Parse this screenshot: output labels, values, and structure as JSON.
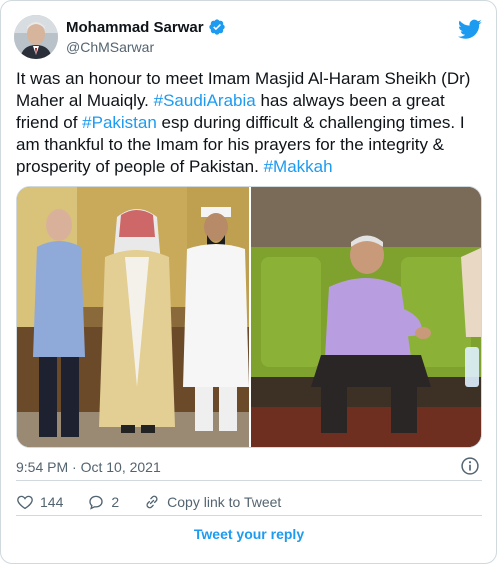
{
  "author": {
    "display_name": "Mohammad Sarwar",
    "handle": "@ChMSarwar"
  },
  "tweet": {
    "segments": [
      {
        "text": "It was an honour to meet Imam Masjid Al-Haram Sheikh (Dr) Maher al Muaiqly. ",
        "link": false
      },
      {
        "text": "#SaudiArabia",
        "link": true
      },
      {
        "text": " has always been a great friend of ",
        "link": false
      },
      {
        "text": "#Pakistan",
        "link": true
      },
      {
        "text": " esp during difficult & challenging times. I am thankful to the Imam for his prayers for the integrity & prosperity of people of Pakistan. ",
        "link": false
      },
      {
        "text": "#Makkah",
        "link": true
      }
    ]
  },
  "timestamp": "9:54 PM · Oct 10, 2021",
  "actions": {
    "likes_count": "144",
    "replies_count": "2",
    "copy_link_label": "Copy link to Tweet"
  },
  "reply_button_label": "Tweet your reply",
  "colors": {
    "accent": "#1d9bf0",
    "text": "#0f1419",
    "muted": "#536471",
    "border": "#cfd9de"
  }
}
